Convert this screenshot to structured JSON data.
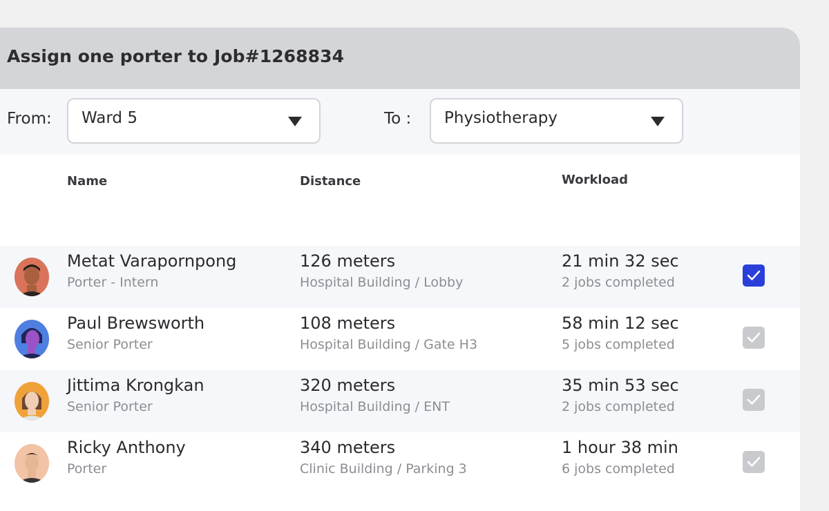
{
  "header": {
    "title": "Assign one porter to Job#1268834"
  },
  "filters": {
    "from_label": "From:",
    "from_value": "Ward 5",
    "to_label": "To :",
    "to_value": "Physiotherapy"
  },
  "table": {
    "columns": [
      "Name",
      "Distance",
      "Workload"
    ],
    "rows": [
      {
        "name": "Metat Varapornpong",
        "role": "Porter - Intern",
        "distance": "126 meters",
        "location": "Hospital Building / Lobby",
        "workload": "21 min 32 sec",
        "jobs": "2 jobs completed",
        "selected": true,
        "avatar_color": "#d9735a"
      },
      {
        "name": "Paul Brewsworth",
        "role": "Senior Porter",
        "distance": "108 meters",
        "location": "Hospital Building / Gate H3",
        "workload": "58 min 12 sec",
        "jobs": "5 jobs completed",
        "selected": false,
        "avatar_color": "#4f7fe0"
      },
      {
        "name": "Jittima Krongkan",
        "role": "Senior Porter",
        "distance": "320 meters",
        "location": "Hospital Building / ENT",
        "workload": "35 min 53 sec",
        "jobs": "2 jobs completed",
        "selected": false,
        "avatar_color": "#f0a23a"
      },
      {
        "name": "Ricky Anthony",
        "role": "Porter",
        "distance": "340 meters",
        "location": "Clinic Building / Parking 3",
        "workload": "1 hour 38 min",
        "jobs": "6 jobs completed",
        "selected": false,
        "avatar_color": "#f3c3a6"
      }
    ]
  },
  "colors": {
    "accent": "#2a3fd9",
    "header_bg": "#d4d5d9",
    "unchecked": "#c9cacd"
  }
}
